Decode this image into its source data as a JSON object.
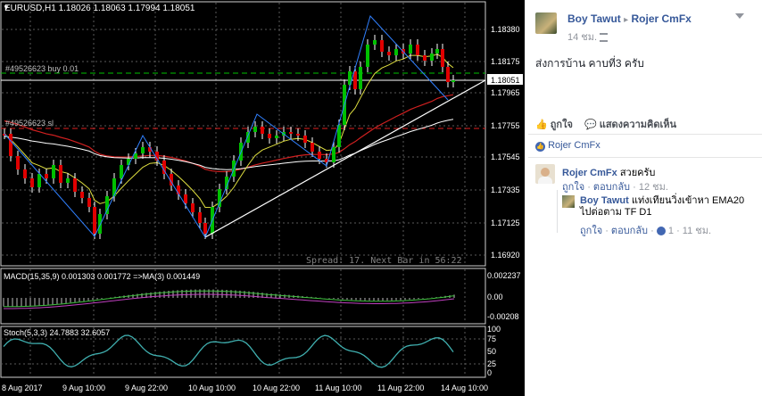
{
  "chart": {
    "header": "EURUSD,H1  1.18026 1.18063 1.17994 1.18051",
    "buy_label": "#49526623 buy 0.01",
    "sl_label": "#49526623 sl",
    "price_tag": "1.18051",
    "spread_text": "Spread: 17. Next Bar in 56:22",
    "macd_label": "MACD(15,35,9) 0.001303 0.001772 =>MA(3) 0.001449",
    "stoch_label": "Stoch(5,3,3) 24.7883 32.6057",
    "price_ticks": [
      "1.18380",
      "1.18175",
      "1.17965",
      "1.17755",
      "1.17545",
      "1.17335",
      "1.17125",
      "1.16920"
    ],
    "macd_ticks": [
      "0.002237",
      "0.00",
      "-0.00208"
    ],
    "stoch_ticks": [
      "100",
      "75",
      "50",
      "25",
      "0"
    ],
    "time_ticks": [
      "8 Aug 2017",
      "9 Aug 10:00",
      "9 Aug 22:00",
      "10 Aug 10:00",
      "10 Aug 22:00",
      "11 Aug 10:00",
      "11 Aug 22:00",
      "14 Aug 10:00"
    ],
    "colors": {
      "bull": "#00c000",
      "bear": "#e00000",
      "ema": "#e0e040",
      "ma_red": "#d02020",
      "ma_white": "#ffffff",
      "zigzag": "#3080ff",
      "trendline": "#ffffff"
    }
  },
  "post": {
    "author": "Boy Tawut",
    "arrow": "▸",
    "group": "Rojer CmFx",
    "time": "14 ชม.",
    "privacy_icon": "group-icon",
    "text": "ส่งการบ้าน คาบที่3 ครับ",
    "like_label": "ถูกใจ",
    "comment_label": "แสดงความคิดเห็น",
    "likers": "Rojer CmFx"
  },
  "comments": [
    {
      "author": "Rojer CmFx",
      "text": "สวยครับ",
      "like": "ถูกใจ",
      "reply": "ตอบกลับ",
      "time": "12 ชม."
    }
  ],
  "reply": {
    "author": "Boy Tawut",
    "text_line1": "แท่งเทียนวิ่งเข้าหา EMA20",
    "text_line2": "ไปต่อตาม TF D1",
    "like": "ถูกใจ",
    "reply": "ตอบกลับ",
    "reactions": "1",
    "time": "11 ชม."
  }
}
